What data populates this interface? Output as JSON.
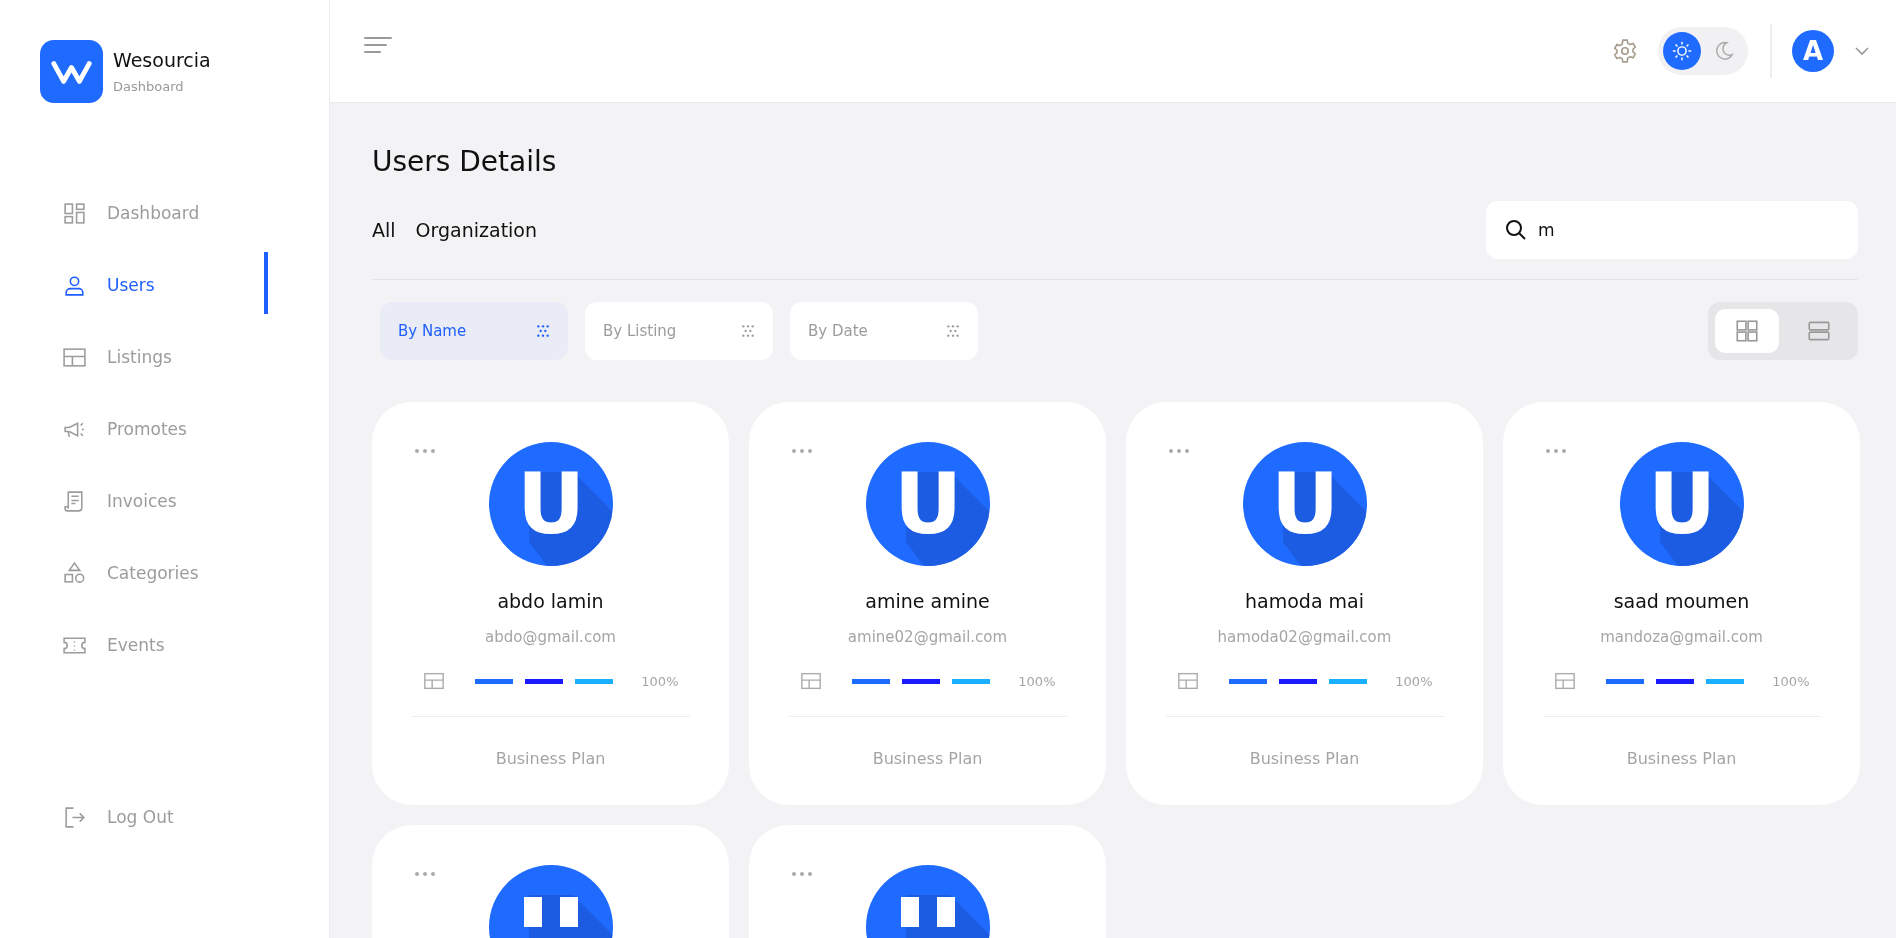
{
  "brand": {
    "name": "Wesourcia",
    "subtitle": "Dashboard"
  },
  "sidebar": {
    "items": [
      {
        "label": "Dashboard",
        "selected": false
      },
      {
        "label": "Users",
        "selected": true
      },
      {
        "label": "Listings",
        "selected": false
      },
      {
        "label": "Promotes",
        "selected": false
      },
      {
        "label": "Invoices",
        "selected": false
      },
      {
        "label": "Categories",
        "selected": false
      },
      {
        "label": "Events",
        "selected": false
      }
    ],
    "logout": "Log Out"
  },
  "header": {
    "theme_toggle": [
      {
        "kind": "sun",
        "selected": true
      },
      {
        "kind": "moon",
        "selected": false
      }
    ],
    "avatar_initial": "A"
  },
  "page_title": "Users Details",
  "tabs": [
    "All",
    "Organization"
  ],
  "search": {
    "value": "m"
  },
  "filters": [
    {
      "label": "By Name",
      "selected": true
    },
    {
      "label": "By Listing",
      "selected": false
    },
    {
      "label": "By Date",
      "selected": false
    }
  ],
  "view_toggle": [
    {
      "kind": "grid",
      "selected": true
    },
    {
      "kind": "rows",
      "selected": false
    }
  ],
  "users": [
    {
      "initial": "U",
      "name": "abdo lamin",
      "email": "abdo@gmail.com",
      "level": 1,
      "reading": "100%",
      "plan": "Business Plan"
    },
    {
      "initial": "U",
      "name": "amine amine",
      "email": "amine02@gmail.com",
      "level": 1,
      "reading": "100%",
      "plan": "Business Plan"
    },
    {
      "initial": "U",
      "name": "hamoda mai",
      "email": "hamoda02@gmail.com",
      "level": 1,
      "reading": "100%",
      "plan": "Business Plan"
    },
    {
      "initial": "U",
      "name": "saad moumen",
      "email": "mandoza@gmail.com",
      "level": 1,
      "reading": "100%",
      "plan": "Business Plan"
    },
    {
      "kind": "cut"
    },
    {
      "kind": "cut"
    }
  ]
}
